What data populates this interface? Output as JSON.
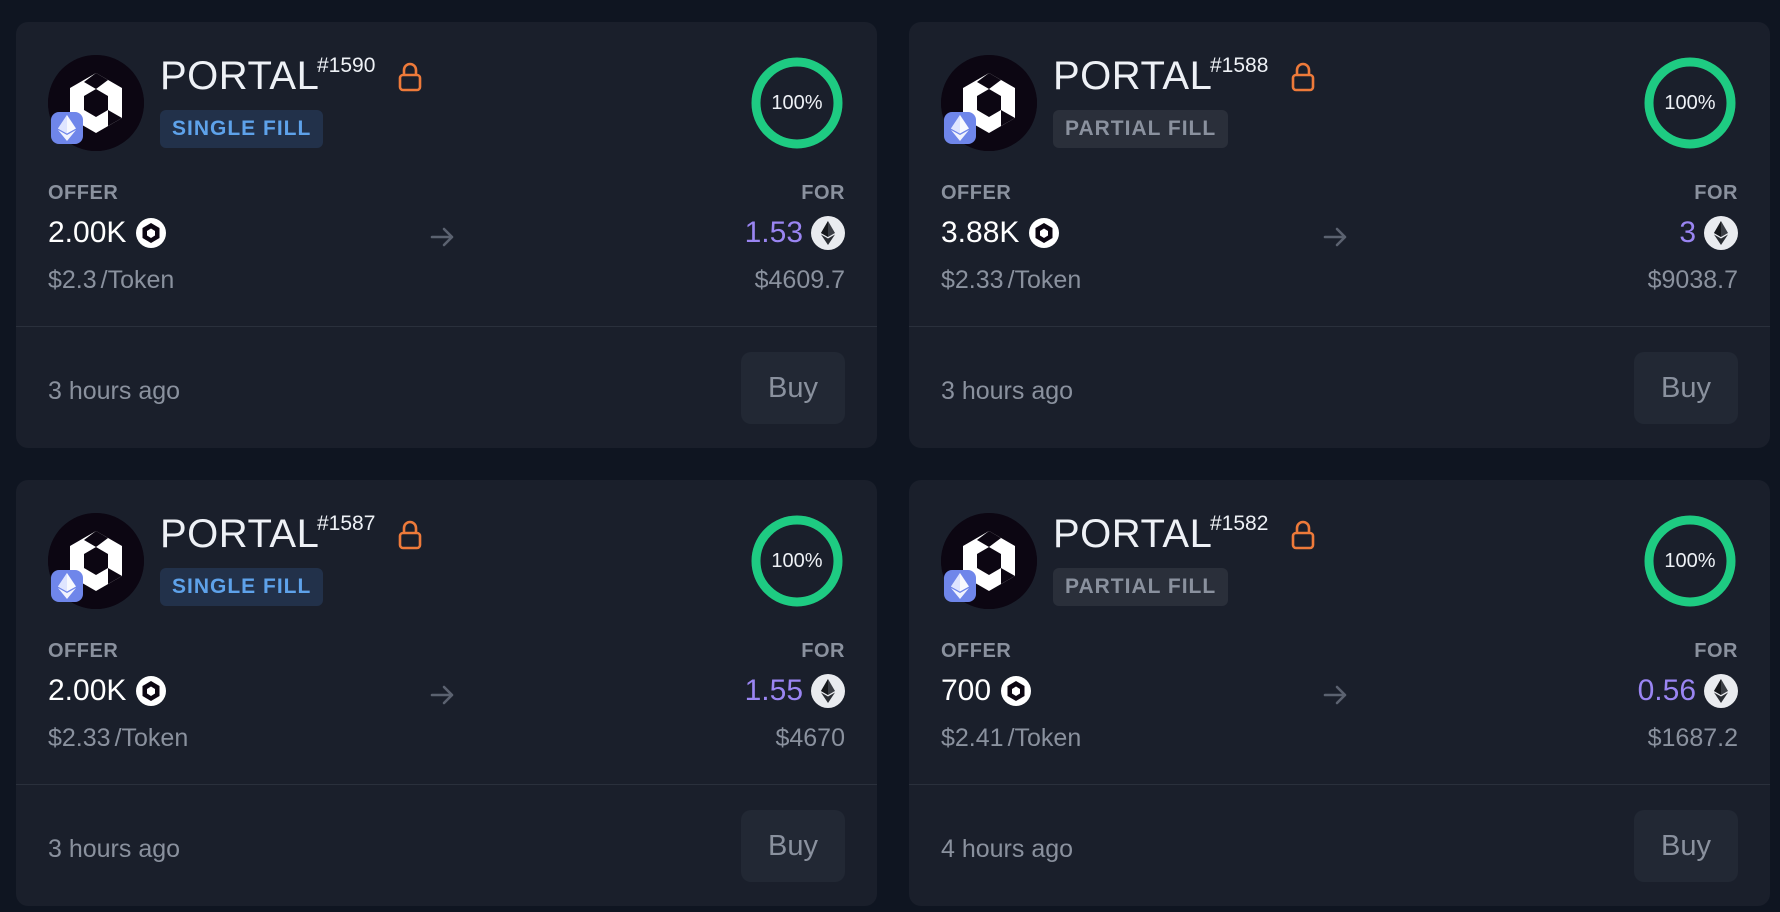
{
  "colors": {
    "background": "#0f1521",
    "card": "#1a1f2b",
    "progress_ring": "#1ecb82",
    "lock": "#ee7a3a",
    "for_amount": "#9a85f2",
    "single_fill_text": "#5ea2ea",
    "partial_fill_text": "#8a919e"
  },
  "icons": {
    "token": "portal-token-icon",
    "chain": "ethereum-chain-icon",
    "lock": "lock-icon",
    "arrow": "arrow-right-icon",
    "for_token": "eth-icon"
  },
  "labels": {
    "offer": "OFFER",
    "for": "FOR",
    "per_token": "/Token",
    "buy": "Buy"
  },
  "orders": [
    {
      "name": "PORTAL",
      "id": "#1590",
      "fill_type": "SINGLE FILL",
      "fill_kind": "single",
      "progress": "100%",
      "progress_value": 1.0,
      "offer_amount": "2.00K",
      "offer_price": "$2.3",
      "for_amount": "1.53",
      "for_usd": "$4609.7",
      "time": "3 hours ago"
    },
    {
      "name": "PORTAL",
      "id": "#1588",
      "fill_type": "PARTIAL FILL",
      "fill_kind": "partial",
      "progress": "100%",
      "progress_value": 1.0,
      "offer_amount": "3.88K",
      "offer_price": "$2.33",
      "for_amount": "3",
      "for_usd": "$9038.7",
      "time": "3 hours ago"
    },
    {
      "name": "PORTAL",
      "id": "#1587",
      "fill_type": "SINGLE FILL",
      "fill_kind": "single",
      "progress": "100%",
      "progress_value": 1.0,
      "offer_amount": "2.00K",
      "offer_price": "$2.33",
      "for_amount": "1.55",
      "for_usd": "$4670",
      "time": "3 hours ago"
    },
    {
      "name": "PORTAL",
      "id": "#1582",
      "fill_type": "PARTIAL FILL",
      "fill_kind": "partial",
      "progress": "100%",
      "progress_value": 1.0,
      "offer_amount": "700",
      "offer_price": "$2.41",
      "for_amount": "0.56",
      "for_usd": "$1687.2",
      "time": "4 hours ago"
    }
  ]
}
